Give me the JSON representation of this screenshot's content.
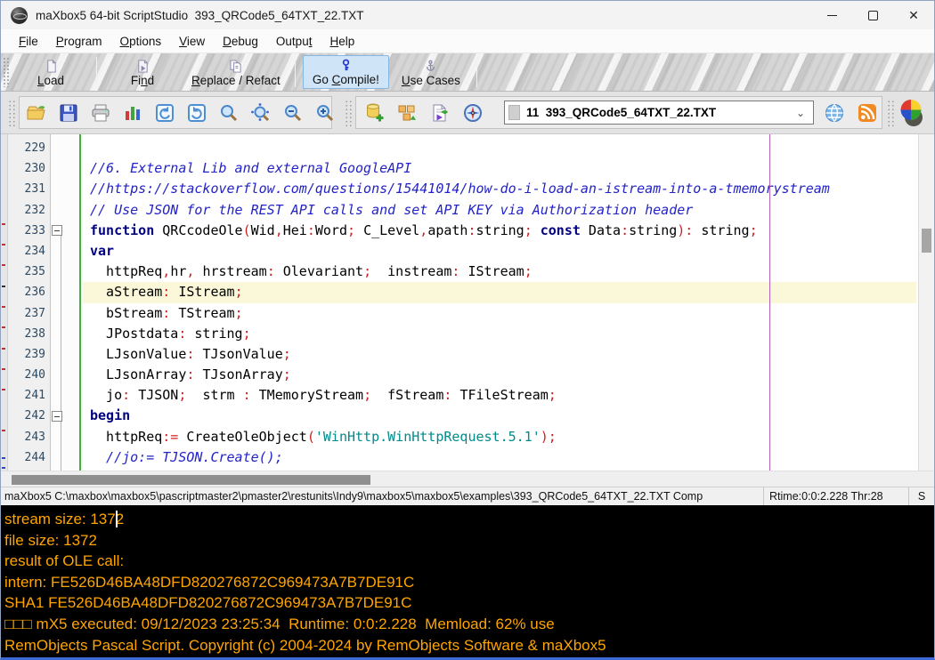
{
  "window": {
    "title": "maXbox5 64-bit ScriptStudio  393_QRCode5_64TXT_22.TXT"
  },
  "menu": {
    "items": [
      {
        "label": "File",
        "u": 0
      },
      {
        "label": "Program",
        "u": 0
      },
      {
        "label": "Options",
        "u": 0
      },
      {
        "label": "View",
        "u": 0
      },
      {
        "label": "Debug",
        "u": 0
      },
      {
        "label": "Output",
        "u": 5
      },
      {
        "label": "Help",
        "u": 0
      }
    ]
  },
  "toolbar_main": {
    "buttons": [
      {
        "id": "load",
        "label": "Load",
        "u": 0,
        "active": false
      },
      {
        "id": "find",
        "label": "Find",
        "u": 2,
        "active": false
      },
      {
        "id": "replace",
        "label": "Replace / Refact",
        "u": 0,
        "active": false
      },
      {
        "id": "compile",
        "label": "Go Compile!",
        "u": 3,
        "active": true
      },
      {
        "id": "usecases",
        "label": "Use Cases",
        "u": 0,
        "active": false
      }
    ]
  },
  "toolbar_icons": {
    "group1": [
      "open-file",
      "save",
      "print",
      "chart",
      "undo",
      "redo",
      "zoom",
      "zoom-pan",
      "zoom-out",
      "zoom-in"
    ],
    "group2": [
      "db-add",
      "bricks",
      "export-run",
      "compass"
    ],
    "dropdown_value": "11  393_QRCode5_64TXT_22.TXT",
    "right": [
      "web-globe",
      "rss-feed",
      "color-ball"
    ]
  },
  "editor": {
    "highlight_line": 236,
    "fold_lines": [
      233,
      242
    ],
    "first_line": 229,
    "lines": [
      {
        "n": 229,
        "tokens": []
      },
      {
        "n": 230,
        "tokens": [
          {
            "c": "cmt",
            "t": "//6. External Lib and external GoogleAPI"
          }
        ]
      },
      {
        "n": 231,
        "tokens": [
          {
            "c": "cmt",
            "t": "//https://stackoverflow.com/questions/15441014/how-do-i-load-an-istream-into-a-tmemorystream"
          }
        ]
      },
      {
        "n": 232,
        "tokens": [
          {
            "c": "cmt",
            "t": "// Use JSON for the REST API calls and set API KEY via Authorization header"
          }
        ]
      },
      {
        "n": 233,
        "tokens": [
          {
            "c": "kw",
            "t": "function"
          },
          {
            "c": "id",
            "t": " QRCcodeOle"
          },
          {
            "c": "sym",
            "t": "("
          },
          {
            "c": "id",
            "t": "Wid"
          },
          {
            "c": "sym",
            "t": ","
          },
          {
            "c": "id",
            "t": "Hei"
          },
          {
            "c": "sym",
            "t": ":"
          },
          {
            "c": "id",
            "t": "Word"
          },
          {
            "c": "sym",
            "t": "; "
          },
          {
            "c": "id",
            "t": "C_Level"
          },
          {
            "c": "sym",
            "t": ","
          },
          {
            "c": "id",
            "t": "apath"
          },
          {
            "c": "sym",
            "t": ":"
          },
          {
            "c": "id",
            "t": "string"
          },
          {
            "c": "sym",
            "t": "; "
          },
          {
            "c": "kw",
            "t": "const"
          },
          {
            "c": "id",
            "t": " Data"
          },
          {
            "c": "sym",
            "t": ":"
          },
          {
            "c": "id",
            "t": "string"
          },
          {
            "c": "sym",
            "t": "): "
          },
          {
            "c": "id",
            "t": "string"
          },
          {
            "c": "sym",
            "t": ";"
          }
        ]
      },
      {
        "n": 234,
        "tokens": [
          {
            "c": "kw",
            "t": "var"
          }
        ]
      },
      {
        "n": 235,
        "tokens": [
          {
            "c": "id",
            "t": "  httpReq"
          },
          {
            "c": "sym",
            "t": ","
          },
          {
            "c": "id",
            "t": "hr"
          },
          {
            "c": "sym",
            "t": ", "
          },
          {
            "c": "id",
            "t": "hrstream"
          },
          {
            "c": "sym",
            "t": ": "
          },
          {
            "c": "id",
            "t": "Olevariant"
          },
          {
            "c": "sym",
            "t": ";  "
          },
          {
            "c": "id",
            "t": "instream"
          },
          {
            "c": "sym",
            "t": ": "
          },
          {
            "c": "id",
            "t": "IStream"
          },
          {
            "c": "sym",
            "t": ";"
          }
        ]
      },
      {
        "n": 236,
        "tokens": [
          {
            "c": "id",
            "t": "  aStream"
          },
          {
            "c": "sym",
            "t": ": "
          },
          {
            "c": "id",
            "t": "IStream"
          },
          {
            "c": "sym",
            "t": ";"
          }
        ]
      },
      {
        "n": 237,
        "tokens": [
          {
            "c": "id",
            "t": "  bStream"
          },
          {
            "c": "sym",
            "t": ": "
          },
          {
            "c": "id",
            "t": "TStream"
          },
          {
            "c": "sym",
            "t": ";"
          }
        ]
      },
      {
        "n": 238,
        "tokens": [
          {
            "c": "id",
            "t": "  JPostdata"
          },
          {
            "c": "sym",
            "t": ": "
          },
          {
            "c": "id",
            "t": "string"
          },
          {
            "c": "sym",
            "t": ";"
          }
        ]
      },
      {
        "n": 239,
        "tokens": [
          {
            "c": "id",
            "t": "  LJsonValue"
          },
          {
            "c": "sym",
            "t": ": "
          },
          {
            "c": "id",
            "t": "TJsonValue"
          },
          {
            "c": "sym",
            "t": ";"
          }
        ]
      },
      {
        "n": 240,
        "tokens": [
          {
            "c": "id",
            "t": "  LJsonArray"
          },
          {
            "c": "sym",
            "t": ": "
          },
          {
            "c": "id",
            "t": "TJsonArray"
          },
          {
            "c": "sym",
            "t": ";"
          }
        ]
      },
      {
        "n": 241,
        "tokens": [
          {
            "c": "id",
            "t": "  jo"
          },
          {
            "c": "sym",
            "t": ": "
          },
          {
            "c": "id",
            "t": "TJSON"
          },
          {
            "c": "sym",
            "t": ";  "
          },
          {
            "c": "id",
            "t": "strm "
          },
          {
            "c": "sym",
            "t": ": "
          },
          {
            "c": "id",
            "t": "TMemoryStream"
          },
          {
            "c": "sym",
            "t": ";  "
          },
          {
            "c": "id",
            "t": "fStream"
          },
          {
            "c": "sym",
            "t": ": "
          },
          {
            "c": "id",
            "t": "TFileStream"
          },
          {
            "c": "sym",
            "t": ";"
          }
        ]
      },
      {
        "n": 242,
        "tokens": [
          {
            "c": "kw",
            "t": "begin"
          }
        ]
      },
      {
        "n": 243,
        "tokens": [
          {
            "c": "id",
            "t": "  httpReq"
          },
          {
            "c": "sym",
            "t": ":= "
          },
          {
            "c": "id",
            "t": "CreateOleObject"
          },
          {
            "c": "sym",
            "t": "("
          },
          {
            "c": "str",
            "t": "'WinHttp.WinHttpRequest.5.1'"
          },
          {
            "c": "sym",
            "t": ");"
          }
        ]
      },
      {
        "n": 244,
        "tokens": [
          {
            "c": "cmt",
            "t": "  //jo:= TJSON.Create();"
          }
        ]
      }
    ]
  },
  "statusbar": {
    "left": "maXbox5 C:\\maxbox\\maxbox5\\pascriptmaster2\\pmaster2\\restunits\\Indy9\\maxbox5\\maxbox5\\examples\\393_QRCode5_64TXT_22.TXT Comp",
    "center": "Rtime:0:0:2.228 Thr:28",
    "right": "S"
  },
  "console": {
    "lines": [
      "stream size: 1372",
      "file size: 1372",
      "result of OLE call:",
      "intern: FE526D46BA48DFD820276872C969473A7B7DE91C",
      "SHA1 FE526D46BA48DFD820276872C969473A7B7DE91C",
      "□□□ mX5 executed: 09/12/2023 23:25:34  Runtime: 0:0:2.228  Memload: 62% use",
      "RemObjects Pascal Script. Copyright (c) 2004-2024 by RemObjects Software & maXbox5"
    ]
  },
  "colors": {
    "console_text": "#FFA500",
    "keyword": "#000080",
    "comment": "#2323C8",
    "symbol": "#C82323",
    "string": "#008B8B",
    "highlight_line": "#FBF8D9",
    "margin_line": "#B85FB8",
    "gutter_separator": "#3CB43C",
    "compile_button_bg": "#CFE4F7"
  }
}
